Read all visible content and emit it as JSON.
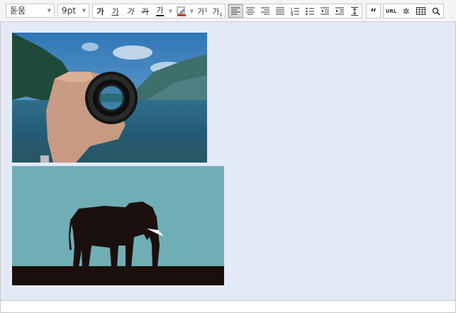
{
  "toolbar": {
    "font_family": {
      "value": "돋움"
    },
    "font_size": {
      "value": "9pt"
    },
    "format": {
      "bold": "가",
      "underline": "가",
      "italic": "가",
      "strikethrough": "가",
      "font_color": "가",
      "superscript_base": "가",
      "superscript_mark": "1",
      "subscript_base": "가",
      "subscript_mark": "1"
    },
    "alignment": {
      "active": "align-left"
    },
    "quote": "“",
    "url": "URL"
  },
  "colors": {
    "editor_bg": "#e4e9f6",
    "toolbar_bg": "#f5f5f5",
    "border": "#c8c8c8",
    "font_color_swatch": "#cc3333"
  },
  "content": {
    "images": [
      {
        "name": "lens-photo",
        "subject": "hand holding a camera lens in front of a lake and mountains"
      },
      {
        "name": "elephant-silhouette",
        "subject": "black elephant silhouette against teal sky"
      }
    ]
  }
}
